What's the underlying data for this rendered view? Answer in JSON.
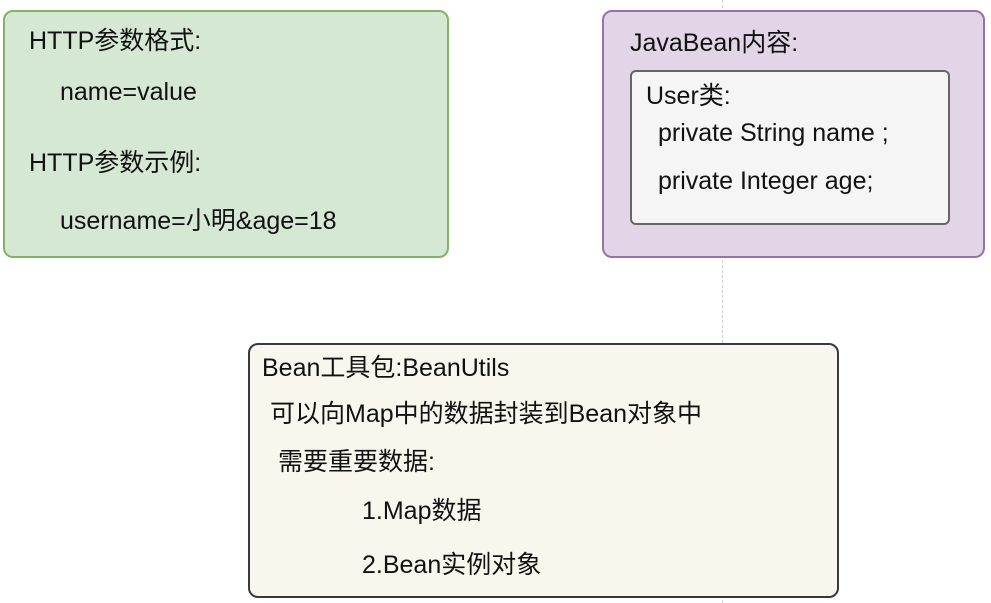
{
  "http_box": {
    "format_title": "HTTP参数格式:",
    "format_value": "name=value",
    "example_title": "HTTP参数示例:",
    "example_value": "username=小明&age=18",
    "fill": "#d5e8d4",
    "stroke": "#82b366"
  },
  "javabean_box": {
    "title": "JavaBean内容:",
    "fill": "#e1d5e7",
    "stroke": "#9673a6",
    "user_class": {
      "title": "User类:",
      "field_1": "private String name ;",
      "field_2": "private Integer age;",
      "fill": "#f5f5f5",
      "stroke": "#666666"
    }
  },
  "beanutils_box": {
    "title": "Bean工具包:BeanUtils",
    "description": "可以向Map中的数据封装到Bean对象中",
    "requires": "需要重要数据:",
    "item_1": "1.Map数据",
    "item_2": "2.Bean实例对象",
    "fill": "#f9f7ed",
    "stroke": "#36393d"
  }
}
